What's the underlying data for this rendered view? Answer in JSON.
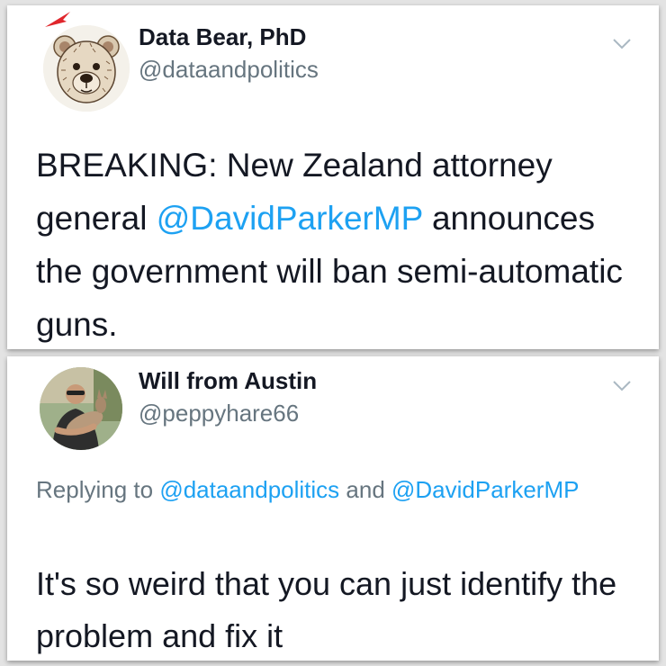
{
  "tweets": [
    {
      "display_name": "Data Bear, PhD",
      "handle": "@dataandpolitics",
      "text_before": "BREAKING: New Zealand attorney general ",
      "mention": "@DavidParkerMP",
      "text_after": " announces the government will ban semi-automatic guns.",
      "avatar_icon": "bear-sketch-avatar",
      "menu_icon": "chevron-down-icon"
    },
    {
      "display_name": "Will from Austin",
      "handle": "@peppyhare66",
      "replying_prefix": "Replying to ",
      "reply_mention_1": "@dataandpolitics",
      "reply_joiner": " and ",
      "reply_mention_2": "@DavidParkerMP",
      "text": "It's so weird that you can just identify the problem and fix it",
      "avatar_icon": "person-holding-animal-avatar",
      "menu_icon": "chevron-down-icon"
    }
  ],
  "colors": {
    "link": "#1da1f2",
    "secondary_text": "#66757f",
    "primary_text": "#141823",
    "background": "#e3e3e3"
  }
}
